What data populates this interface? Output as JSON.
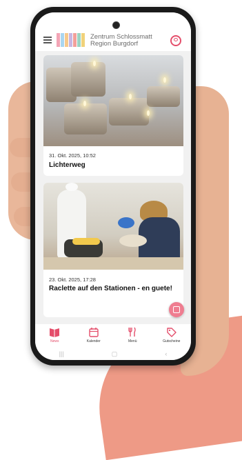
{
  "app": {
    "logo_line1": "Zentrum Schlossmatt",
    "logo_line2": "Region Burgdorf",
    "logo_colors": [
      "#f3a5b6",
      "#a9d6f0",
      "#f7c98b",
      "#c8b6e2",
      "#f2a09a",
      "#9bd3c2",
      "#f0d27a"
    ]
  },
  "posts": [
    {
      "date": "31. Okt. 2025, 10:52",
      "title": "Lichterweg"
    },
    {
      "date": "23. Okt. 2025, 17:28",
      "title": "Raclette auf den Stationen - en guete!"
    }
  ],
  "tabs": [
    {
      "label": "News",
      "icon": "news-icon",
      "active": true
    },
    {
      "label": "Kalender",
      "icon": "calendar-icon",
      "active": false
    },
    {
      "label": "Menü",
      "icon": "cutlery-icon",
      "active": false
    },
    {
      "label": "Gutscheine",
      "icon": "voucher-tag-icon",
      "active": false
    }
  ],
  "colors": {
    "accent": "#e44d6a",
    "fab": "#ef7d90",
    "background": "#f1f1f1"
  }
}
